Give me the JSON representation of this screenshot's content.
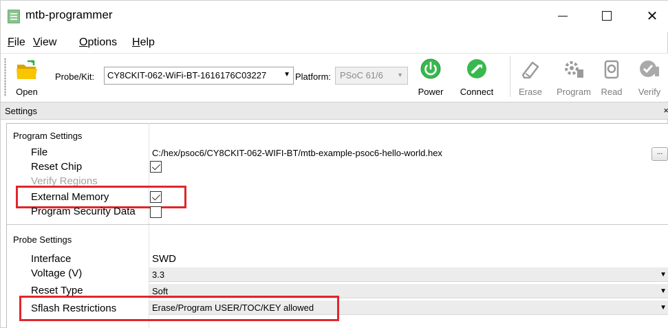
{
  "window": {
    "title": "mtb-programmer",
    "minimize_glyph": "",
    "close_glyph": "✕"
  },
  "menu": [
    "File",
    "View",
    "Options",
    "Help"
  ],
  "menu_mnemonics": [
    "F",
    "V",
    "O",
    "H"
  ],
  "toolbar": {
    "open_label": "Open",
    "probe_label": "Probe/Kit:",
    "probe_value": "CY8CKIT-062-WiFi-BT-1616176C03227",
    "platform_label": "Platform:",
    "platform_value": "PSoC 61/6",
    "power_label": "Power",
    "connect_label": "Connect",
    "erase_label": "Erase",
    "program_label": "Program",
    "read_label": "Read",
    "verify_label": "Verify",
    "icons": [
      "folder-icon",
      "power-icon",
      "connect-icon",
      "erase-icon",
      "program-icon",
      "read-icon",
      "verify-icon"
    ],
    "colors": {
      "power": "#3fbf55",
      "connect": "#3fbf55",
      "folder": "#f5c400",
      "folder_dark": "#d9a300"
    }
  },
  "settings": {
    "header": "Settings",
    "close_glyph": "×",
    "program_settings": {
      "title": "Program Settings",
      "file_label": "File",
      "file_value": "C:/hex/psoc6/CY8CKIT-062-WIFI-BT/mtb-example-psoc6-hello-world.hex",
      "browse_label": "...",
      "reset_chip_label": "Reset Chip",
      "reset_chip_checked": true,
      "verify_regions_label": "Verify Regions",
      "external_memory_label": "External Memory",
      "external_memory_checked": true,
      "program_security_label": "Program Security Data",
      "program_security_checked": false
    },
    "probe_settings": {
      "title": "Probe Settings",
      "interface_label": "Interface",
      "interface_value": "SWD",
      "voltage_label": "Voltage (V)",
      "voltage_value": "3.3",
      "reset_type_label": "Reset Type",
      "reset_type_value": "Soft",
      "sflash_label": "Sflash Restrictions",
      "sflash_value": "Erase/Program USER/TOC/KEY allowed"
    }
  },
  "highlight_color": "#e0262b"
}
